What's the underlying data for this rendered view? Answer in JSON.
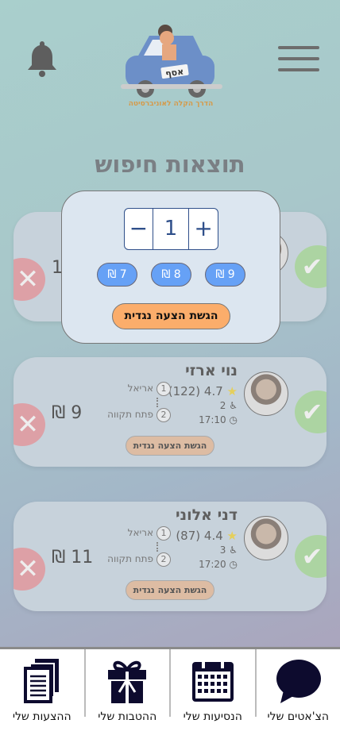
{
  "header": {
    "title": "תוצאות חיפוש",
    "logo_plate": "אסף",
    "logo_slogan": "הדרך הקלה לאוניברסיטה"
  },
  "popup": {
    "quantity": "1",
    "minus": "−",
    "plus": "+",
    "price_options": [
      "7 ₪",
      "8 ₪",
      "9 ₪"
    ],
    "submit_label": "הגשת הצעה נגדית"
  },
  "cards": [
    {
      "price": "1"
    },
    {
      "name": "נוי ארזי",
      "rating": "4.7",
      "reviews": "(122)",
      "seats": "2",
      "time": "17:10",
      "from": "אריאל",
      "to": "פתח תקווה",
      "stop1": "1",
      "stop2": "2",
      "price": "9 ₪",
      "counter_label": "הגשת הצעה נגדית"
    },
    {
      "name": "דני אלוני",
      "rating": "4.4",
      "reviews": "(87)",
      "seats": "3",
      "time": "17:20",
      "from": "אריאל",
      "to": "פתח תקווה",
      "stop1": "1",
      "stop2": "2",
      "price": "11 ₪",
      "counter_label": "הגשת הצעה נגדית"
    }
  ],
  "nav": [
    {
      "label": "הצ'אטים שלי"
    },
    {
      "label": "הנסיעות שלי"
    },
    {
      "label": "ההטבות שלי"
    },
    {
      "label": "ההצעות שלי"
    }
  ],
  "colors": {
    "accept": "#acd4a2",
    "reject": "#dda0a6",
    "chip": "#66a1f6",
    "submit": "#fbad6b",
    "nav_icon": "#0d0b2e"
  }
}
